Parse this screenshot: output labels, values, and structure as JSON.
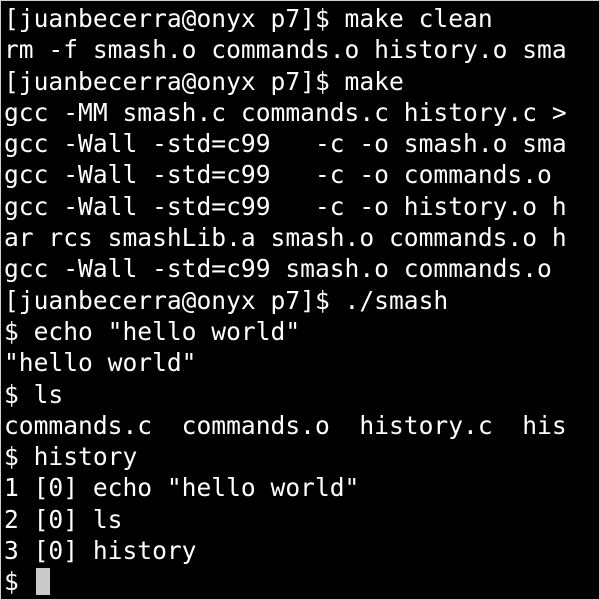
{
  "terminal": {
    "lines": [
      "[juanbecerra@onyx p7]$ make clean",
      "rm -f smash.o commands.o history.o sma",
      "[juanbecerra@onyx p7]$ make",
      "gcc -MM smash.c commands.c history.c >",
      "gcc -Wall -std=c99   -c -o smash.o sma",
      "gcc -Wall -std=c99   -c -o commands.o",
      "gcc -Wall -std=c99   -c -o history.o h",
      "ar rcs smashLib.a smash.o commands.o h",
      "gcc -Wall -std=c99 smash.o commands.o",
      "[juanbecerra@onyx p7]$ ./smash",
      "$ echo \"hello world\"",
      "\"hello world\"",
      "$ ls",
      "commands.c  commands.o  history.c  his",
      "$ history",
      "1 [0] echo \"hello world\"",
      "2 [0] ls",
      "3 [0] history"
    ],
    "prompt": "$ "
  }
}
